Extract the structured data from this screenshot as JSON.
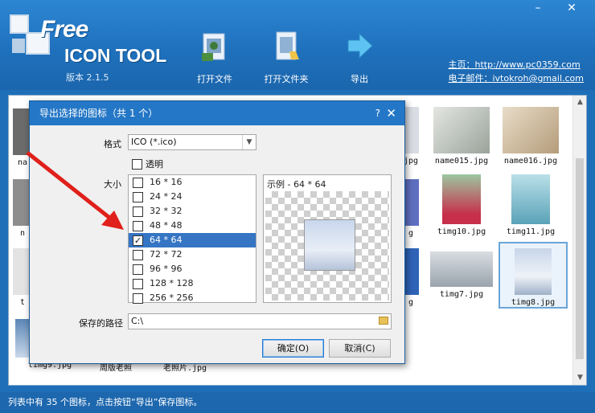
{
  "window": {
    "minimize_glyph": "–",
    "close_glyph": "✕"
  },
  "header": {
    "logo_free": "Free",
    "logo_tool": "ICON TOOL",
    "version": "版本 2.1.5",
    "toolbar": [
      {
        "label": "打开文件",
        "icon": "open-file-icon"
      },
      {
        "label": "打开文件夹",
        "icon": "open-folder-icon"
      },
      {
        "label": "导出",
        "icon": "export-arrow-icon"
      }
    ],
    "homepage_link": "主页：http://www.pc0359.com",
    "email_link": "电子邮件：ivtokroh@gmail.com"
  },
  "gallery": {
    "items": [
      {
        "caption": "na",
        "pos": "r1c1"
      },
      {
        "caption": "jpg",
        "pos": "r1c6"
      },
      {
        "caption": "name015.jpg",
        "pos": "r1c7"
      },
      {
        "caption": "name016.jpg",
        "pos": "r1c8"
      },
      {
        "caption": "n",
        "pos": "r2c1"
      },
      {
        "caption": "g",
        "pos": "r2c6"
      },
      {
        "caption": "timg10.jpg",
        "pos": "r2c7"
      },
      {
        "caption": "timg11.jpg",
        "pos": "r2c8"
      },
      {
        "caption": "t",
        "pos": "r3c1"
      },
      {
        "caption": "g",
        "pos": "r3c6"
      },
      {
        "caption": "timg7.jpg",
        "pos": "r3c7"
      },
      {
        "caption": "timg8.jpg",
        "pos": "r3c8"
      },
      {
        "caption": "timg9.jpg",
        "pos": "r4c1"
      },
      {
        "caption": "周版老照",
        "pos": "r4c2"
      },
      {
        "caption": "老照片.jpg",
        "pos": "r4c3"
      }
    ],
    "selected_caption": "timg8.jpg"
  },
  "dialog": {
    "title": "导出选择的图标（共 1 个）",
    "help_glyph": "?",
    "close_glyph": "✕",
    "format_label": "格式",
    "format_value": "ICO (*.ico)",
    "transparent_label": "透明",
    "transparent_checked": false,
    "size_label": "大小",
    "sizes": [
      {
        "label": "16 * 16",
        "checked": false
      },
      {
        "label": "24 * 24",
        "checked": false
      },
      {
        "label": "32 * 32",
        "checked": false
      },
      {
        "label": "48 * 48",
        "checked": false
      },
      {
        "label": "64 * 64",
        "checked": true
      },
      {
        "label": "72 * 72",
        "checked": false
      },
      {
        "label": "96 * 96",
        "checked": false
      },
      {
        "label": "128 * 128",
        "checked": false
      },
      {
        "label": "256 * 256",
        "checked": false
      }
    ],
    "selected_size": "64 * 64",
    "preview_label": "示例 - 64 * 64",
    "path_label": "保存的路径",
    "path_value": "C:\\",
    "ok_button": "确定(O)",
    "cancel_button": "取消(C)"
  },
  "status": {
    "text": "列表中有 35 个图标，点击按钮“导出”保存图标。"
  },
  "colors": {
    "header_blue": "#1f71bd",
    "dialog_title_blue": "#2477c6",
    "selection_blue": "#3575c4",
    "arrow_red": "#e0201b"
  }
}
